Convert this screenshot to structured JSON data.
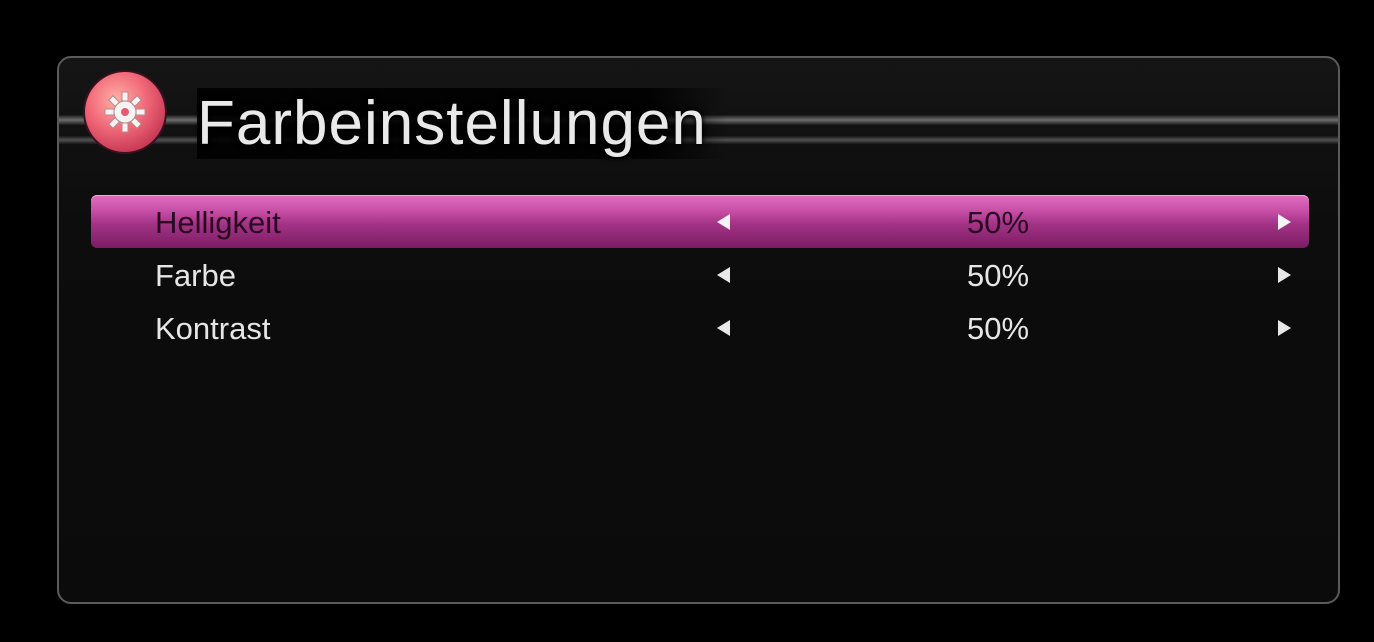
{
  "header": {
    "title": "Farbeinstellungen",
    "icon": "gear-icon"
  },
  "menu": {
    "items": [
      {
        "label": "Helligkeit",
        "value": "50%",
        "selected": true
      },
      {
        "label": "Farbe",
        "value": "50%",
        "selected": false
      },
      {
        "label": "Kontrast",
        "value": "50%",
        "selected": false
      }
    ]
  },
  "colors": {
    "highlight": "#c84ea6",
    "icon_accent": "#f26b7a",
    "text": "#e6e6e6"
  }
}
